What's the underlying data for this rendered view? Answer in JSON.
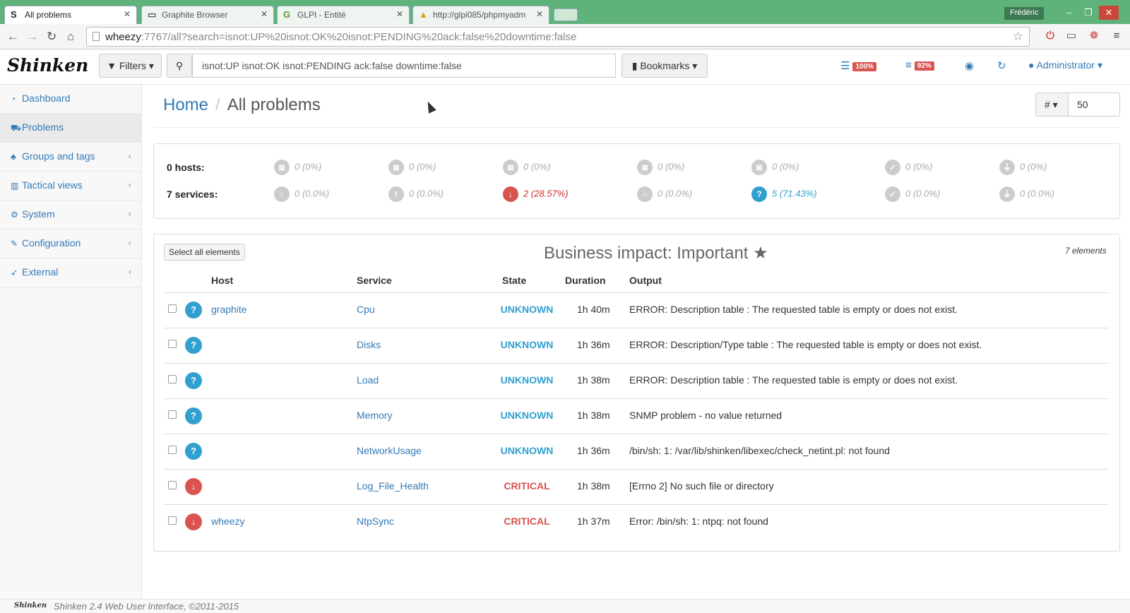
{
  "browser": {
    "tabs": [
      {
        "icon": "S",
        "title": "All problems",
        "active": true
      },
      {
        "icon": "▭",
        "title": "Graphite Browser",
        "active": false
      },
      {
        "icon": "G",
        "title": "GLPI - Entité",
        "active": false
      },
      {
        "icon": "▲",
        "title": "http://glpi085/phpmyadm",
        "active": false
      }
    ],
    "user": "Frédéric",
    "url_host": "wheezy",
    "url_rest": ":7767/all?search=isnot:UP%20isnot:OK%20isnot:PENDING%20ack:false%20downtime:false"
  },
  "topnav": {
    "logo": "Shinken",
    "filters_label": "Filters",
    "search_value": "isnot:UP isnot:OK isnot:PENDING ack:false downtime:false",
    "bookmarks_label": "Bookmarks",
    "hosts_pct": "100%",
    "services_pct": "92%",
    "admin_label": "Administrator"
  },
  "sidebar": {
    "items": [
      {
        "icon": "dashboard-icon",
        "label": "Dashboard"
      },
      {
        "icon": "problems-icon",
        "label": "Problems"
      },
      {
        "icon": "groups-icon",
        "label": "Groups and tags"
      },
      {
        "icon": "chart-icon",
        "label": "Tactical views"
      },
      {
        "icon": "cogs-icon",
        "label": "System"
      },
      {
        "icon": "wrench-icon",
        "label": "Configuration"
      },
      {
        "icon": "rocket-icon",
        "label": "External"
      }
    ]
  },
  "breadcrumb": {
    "home": "Home",
    "current": "All problems"
  },
  "perpage": {
    "label": "#",
    "value": "50"
  },
  "counters": {
    "hosts_label": "0 hosts:",
    "services_label": "7 services:",
    "hosts": [
      "0 (0%)",
      "0 (0%)",
      "0 (0%)",
      "0 (0%)",
      "0 (0%)",
      "0 (0%)",
      "0 (0%)"
    ],
    "services": [
      "0 (0.0%)",
      "0 (0.0%)",
      "2 (28.57%)",
      "0 (0.0%)",
      "5 (71.43%)",
      "0 (0.0%)",
      "0 (0.0%)"
    ]
  },
  "problems": {
    "select_all": "Select all elements",
    "title": "Business impact: Important",
    "count": "7 elements",
    "columns": {
      "host": "Host",
      "service": "Service",
      "state": "State",
      "duration": "Duration",
      "output": "Output"
    },
    "rows": [
      {
        "host": "graphite",
        "service": "Cpu",
        "state": "UNKNOWN",
        "duration": "1h 40m",
        "output": "ERROR: Description table : The requested table is empty or does not exist."
      },
      {
        "host": "",
        "service": "Disks",
        "state": "UNKNOWN",
        "duration": "1h 36m",
        "output": "ERROR: Description/Type table : The requested table is empty or does not exist."
      },
      {
        "host": "",
        "service": "Load",
        "state": "UNKNOWN",
        "duration": "1h 38m",
        "output": "ERROR: Description table : The requested table is empty or does not exist."
      },
      {
        "host": "",
        "service": "Memory",
        "state": "UNKNOWN",
        "duration": "1h 38m",
        "output": "SNMP problem - no value returned"
      },
      {
        "host": "",
        "service": "NetworkUsage",
        "state": "UNKNOWN",
        "duration": "1h 36m",
        "output": "/bin/sh: 1: /var/lib/shinken/libexec/check_netint.pl: not found"
      },
      {
        "host": "",
        "service": "Log_File_Health",
        "state": "CRITICAL",
        "duration": "1h 38m",
        "output": "[Errno 2] No such file or directory"
      },
      {
        "host": "wheezy",
        "service": "NtpSync",
        "state": "CRITICAL",
        "duration": "1h 37m",
        "output": "Error: /bin/sh: 1: ntpq: not found"
      }
    ]
  },
  "colors": {
    "unknown": "#31a0cf",
    "critical": "#d9534f",
    "link": "#337ab7"
  },
  "footer": {
    "logo": "Shinken",
    "text": "Shinken 2.4 Web User Interface, ©2011-2015"
  }
}
